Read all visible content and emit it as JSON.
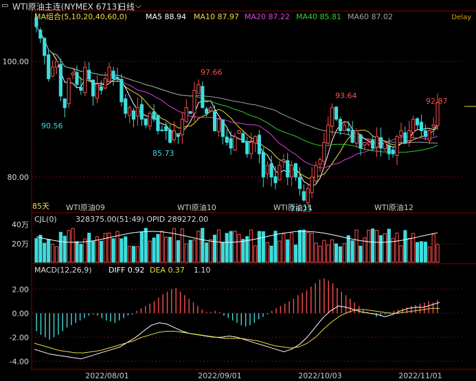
{
  "header": {
    "title": "WTI原油主连(NYMEX 6713)",
    "period": "日线",
    "delay": "Delay"
  },
  "main_legend": {
    "group": "MA组合(5,10,20,40,60,0)",
    "ma5": "MA5 88.94",
    "ma10": "MA10 87.97",
    "ma20": "MA20 87.22",
    "ma40": "MA40 85.81",
    "ma60": "MA60 87.02"
  },
  "main_axis": {
    "labels": [
      "100.00",
      "80.00"
    ]
  },
  "annotations": {
    "days": "85天"
  },
  "price_marks": [
    "90.56",
    "97.66",
    "85.73",
    "93.64",
    "92.87",
    "76.25"
  ],
  "contracts": [
    "WTI原油09",
    "WTI原油10",
    "WTI原油11",
    "WTI原油12"
  ],
  "vol_legend": {
    "name": "CJL(0)",
    "values": "328375.00(51:49)  OPID 289272.00"
  },
  "vol_axis": {
    "labels": [
      "40万",
      "20万"
    ]
  },
  "macd_legend": {
    "name": "MACD(12,26,9)",
    "diff": "DIFF 0.92",
    "dea": "DEA 0.37",
    "macd": "1.10"
  },
  "macd_axis": {
    "labels": [
      "2.00",
      "0.00",
      "-2.00",
      "-4.00"
    ]
  },
  "x_axis": {
    "labels": [
      "2022/08/01",
      "2022/09/01",
      "2022/10/03",
      "2022/11/01"
    ]
  },
  "colors": {
    "up": "#ff5050",
    "down": "#3fdcdc",
    "ma5": "#ffffff",
    "ma10": "#e8e040",
    "ma20": "#e040e0",
    "ma40": "#30d030",
    "ma60": "#a0a0a0"
  },
  "chart_data": {
    "type": "candlestick",
    "price_ylim": [
      75,
      108
    ],
    "closes": [
      106,
      104,
      101,
      97,
      99,
      100,
      94,
      92,
      97,
      98,
      96,
      95,
      99,
      97,
      94,
      96,
      95,
      97,
      99,
      97,
      97,
      93,
      91,
      92,
      90,
      92,
      90,
      89,
      91,
      90,
      88,
      88,
      88,
      86,
      88,
      87,
      90,
      92,
      91,
      95,
      96,
      92,
      91,
      92,
      88,
      90,
      87,
      86,
      85,
      87,
      88,
      86,
      84,
      86,
      87,
      84,
      80,
      82,
      80,
      79,
      82,
      83,
      80,
      82,
      80,
      78,
      76,
      78,
      80,
      82,
      83,
      86,
      89,
      92,
      90,
      88,
      89,
      88,
      86,
      88,
      85,
      86,
      86,
      85,
      87,
      85,
      86,
      84,
      84,
      87,
      88,
      86,
      88,
      90,
      89,
      88,
      87,
      88,
      89,
      92.9
    ],
    "macd_bars": [
      -1.5,
      -1.8,
      -2.0,
      -2.2,
      -2.0,
      -1.8,
      -1.5,
      -1.2,
      -1.0,
      -0.8,
      -0.6,
      -0.4,
      -0.2,
      -0.1,
      -0.2,
      -0.4,
      -0.6,
      -0.7,
      -0.8,
      -0.6,
      -0.4,
      -0.2,
      -0.1,
      0.2,
      0.4,
      0.6,
      0.8,
      1.0,
      1.3,
      1.6,
      1.8,
      2.0,
      2.1,
      1.8,
      1.5,
      1.2,
      0.9,
      0.6,
      0.3,
      0.1,
      0.1,
      0.2,
      0.1,
      -0.2,
      -0.4,
      -0.6,
      -0.8,
      -1.0,
      -1.1,
      -1.0,
      -0.8,
      -0.5,
      -0.3,
      -0.1,
      0.2,
      0.4,
      0.6,
      0.8,
      1.0,
      1.2,
      1.5,
      1.7,
      1.9,
      2.2,
      2.5,
      2.8,
      2.9,
      2.7,
      2.5,
      2.1,
      1.8,
      1.5,
      1.2,
      0.9,
      0.6,
      0.3,
      0.1,
      -0.1,
      -0.3,
      -0.2,
      -0.1,
      0.1,
      0.2,
      0.3,
      0.4,
      0.5,
      0.6,
      0.7,
      0.8,
      0.9,
      1.0,
      0.9,
      1.1
    ],
    "diff_line": [
      -3.0,
      -3.2,
      -3.4,
      -3.5,
      -3.6,
      -3.7,
      -3.8,
      -3.6,
      -3.4,
      -3.2,
      -3.0,
      -2.8,
      -2.4,
      -2.0,
      -1.5,
      -1.0,
      -0.8,
      -0.9,
      -1.2,
      -1.5,
      -1.7,
      -1.8,
      -1.9,
      -2.0,
      -2.0,
      -1.9,
      -2.0,
      -2.2,
      -2.4,
      -2.6,
      -2.8,
      -3.0,
      -3.2,
      -3.0,
      -2.6,
      -2.0,
      -1.2,
      -0.4,
      0.2,
      0.6,
      0.5,
      0.3,
      0.1,
      0.0,
      -0.1,
      -0.3,
      -0.1,
      0.2,
      0.4,
      0.5,
      0.5,
      0.7,
      0.9
    ],
    "dea_line": [
      -2.5,
      -2.7,
      -2.9,
      -3.1,
      -3.2,
      -3.3,
      -3.3,
      -3.2,
      -3.1,
      -2.9,
      -2.7,
      -2.5,
      -2.3,
      -2.0,
      -1.8,
      -1.6,
      -1.5,
      -1.5,
      -1.6,
      -1.7,
      -1.8,
      -1.9,
      -2.0,
      -2.1,
      -2.1,
      -2.1,
      -2.2,
      -2.3,
      -2.5,
      -2.7,
      -2.8,
      -2.9,
      -2.8,
      -2.5,
      -2.0,
      -1.3,
      -0.7,
      -0.2,
      0.1,
      0.3,
      0.3,
      0.2,
      0.1,
      0.0,
      0.0,
      0.1,
      0.2,
      0.3,
      0.4,
      0.4
    ]
  }
}
